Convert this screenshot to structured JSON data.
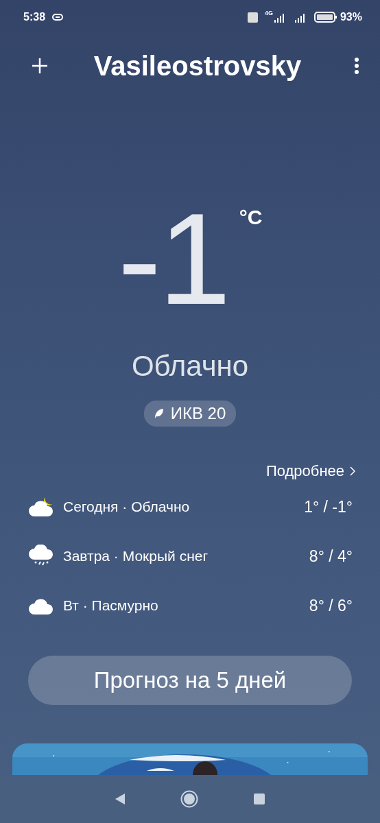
{
  "status_bar": {
    "time": "5:38",
    "network": "4G",
    "battery": "93%"
  },
  "header": {
    "title": "Vasileostrovsky"
  },
  "current": {
    "temperature": "-1",
    "unit": "°C",
    "condition": "Облачно",
    "aqi": "ИКВ 20"
  },
  "details_link": "Подробнее",
  "forecast": [
    {
      "kind": "partly_cloudy_night",
      "label": "Сегодня · Облачно",
      "temps": "1° / -1°"
    },
    {
      "kind": "sleet",
      "label": "Завтра · Мокрый снег",
      "temps": "8° / 4°"
    },
    {
      "kind": "cloudy",
      "label": "Вт · Пасмурно",
      "temps": "8° / 6°"
    }
  ],
  "forecast_button": "Прогноз на 5 дней"
}
